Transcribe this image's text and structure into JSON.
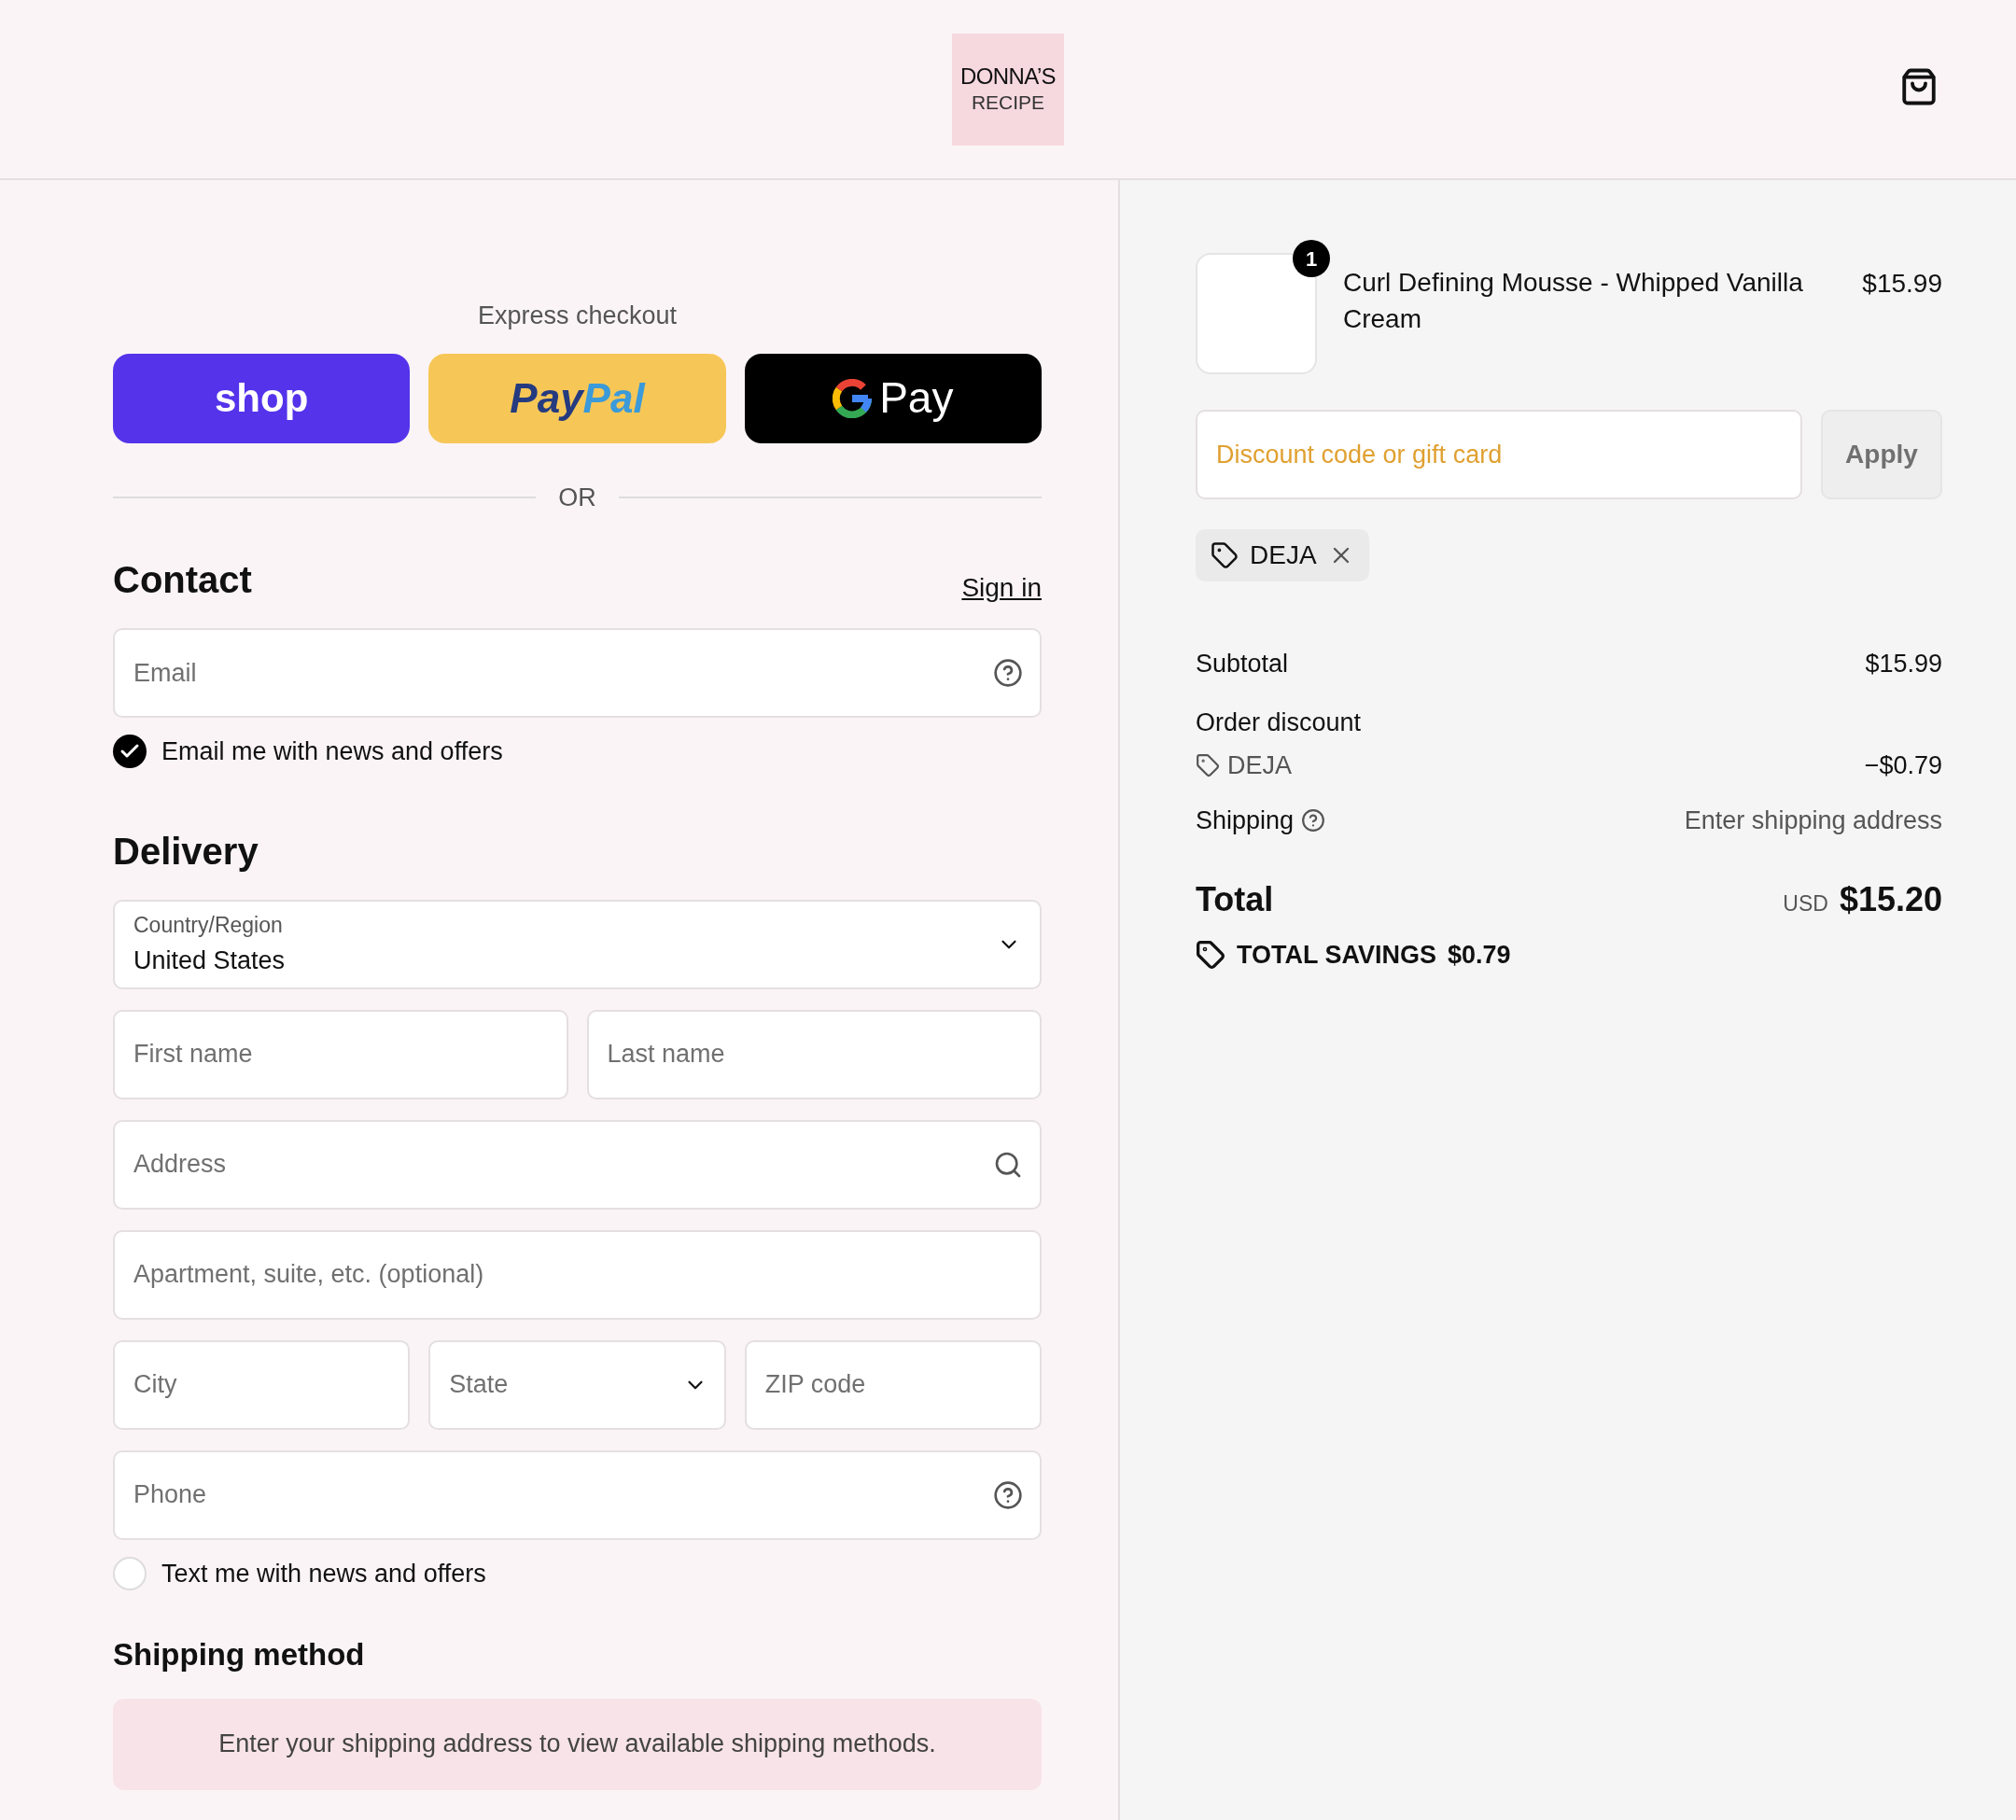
{
  "header": {
    "logo": {
      "line_1": "DONNA’S",
      "line_2": "RECIPE"
    }
  },
  "express": {
    "title": "Express checkout",
    "buttons": [
      {
        "kind": "shop",
        "parts": [
          "shop"
        ]
      },
      {
        "kind": "paypal",
        "parts": [
          "Pay",
          "Pal"
        ]
      },
      {
        "kind": "gpay",
        "parts": [
          "Pay"
        ]
      }
    ],
    "divider": "OR"
  },
  "contact": {
    "title": "Contact",
    "link": "Sign in",
    "email": {
      "placeholder": "Email"
    },
    "news": {
      "label": "Email me with news and offers",
      "checked": true
    }
  },
  "delivery": {
    "title": "Delivery",
    "country": {
      "label": "Country/Region",
      "value": "United States"
    },
    "first_name": {
      "placeholder": "First name"
    },
    "last_name": {
      "placeholder": "Last name"
    },
    "address": {
      "placeholder": "Address"
    },
    "apartment": {
      "placeholder": "Apartment, suite, etc. (optional)"
    },
    "city": {
      "placeholder": "City"
    },
    "state": {
      "placeholder": "State"
    },
    "zip": {
      "placeholder": "ZIP code"
    },
    "phone": {
      "placeholder": "Phone"
    },
    "text_news": {
      "label": "Text me with news and offers",
      "checked": false
    }
  },
  "shipping_method": {
    "title": "Shipping method",
    "notice": "Enter your shipping address to view available shipping methods."
  },
  "summary": {
    "product": {
      "name": "Curl Defining Mousse - Whipped Vanilla Cream",
      "price": "$15.99",
      "quantity": "1"
    },
    "discount": {
      "placeholder": "Discount code or gift card",
      "button": "Apply"
    },
    "applied_code": "DEJA",
    "subtotal": {
      "label": "Subtotal",
      "value": "$15.99"
    },
    "order_discount": {
      "label": "Order discount",
      "code": "DEJA",
      "value": "−$0.79"
    },
    "shipping": {
      "label": "Shipping",
      "value": "Enter shipping address"
    },
    "total": {
      "label": "Total",
      "currency": "USD",
      "value": "$15.20"
    },
    "savings": {
      "label": "TOTAL SAVINGS",
      "value": "$0.79"
    }
  }
}
